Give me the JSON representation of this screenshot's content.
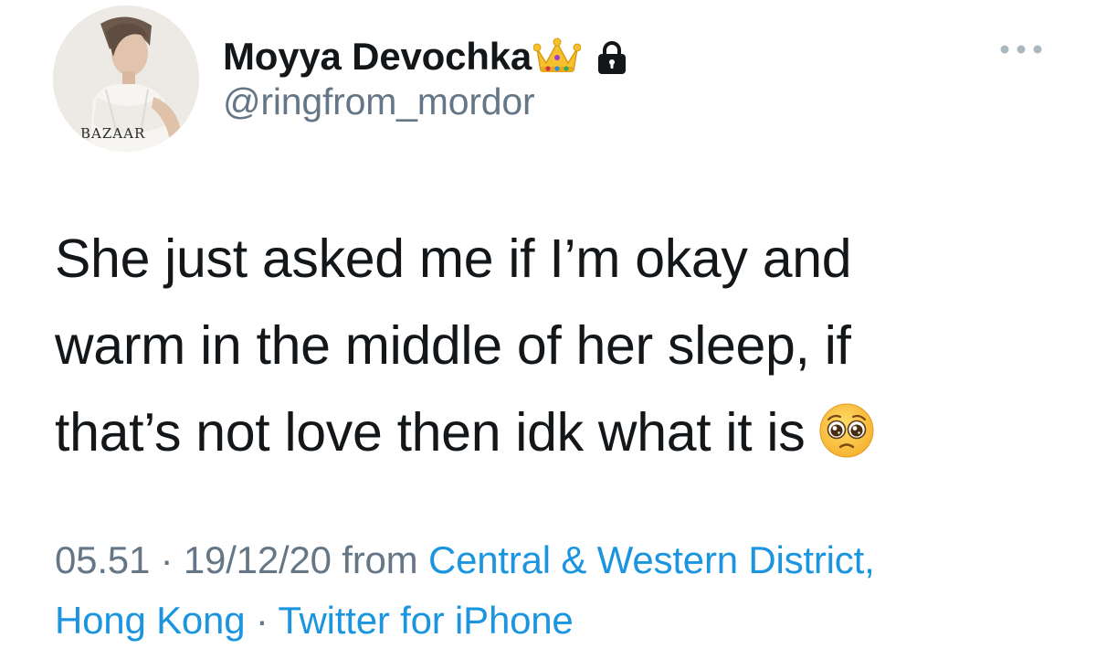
{
  "user": {
    "display_name": "Moyya Devochka",
    "handle": "@ringfrom_mordor",
    "avatar_logo_text": "BAZAAR",
    "name_badges": [
      "crown-emoji",
      "lock-icon"
    ]
  },
  "header": {
    "more_icon": "more-horizontal-icon"
  },
  "tweet": {
    "lines": [
      "She just asked me if I’m okay and",
      "warm in the middle of her sleep, if",
      "that’s not love then idk what it is"
    ],
    "trailing_emoji": "pleading-face-emoji"
  },
  "meta": {
    "time": "05.51",
    "separator": "·",
    "date": "19/12/20",
    "from_label": "from",
    "location_part1": "Central & Western District,",
    "location_part2": "Hong Kong",
    "client": "Twitter for iPhone"
  },
  "colors": {
    "text": "#14171a",
    "secondary": "#657786",
    "link": "#1b95e0",
    "background": "#ffffff"
  }
}
